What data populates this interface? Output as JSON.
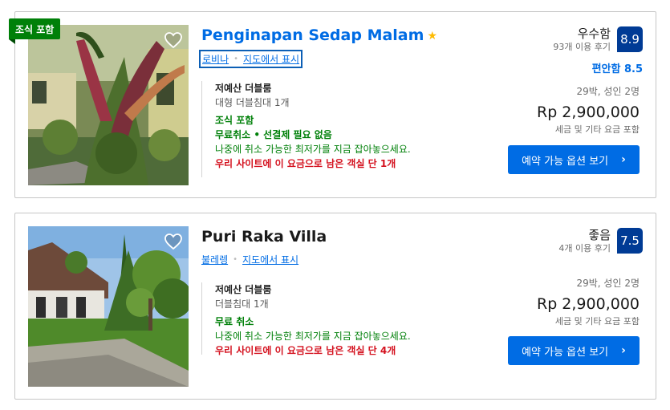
{
  "listings": [
    {
      "name": "Penginapan Sedap Malam",
      "star": "★",
      "ribbon": "조식 포함",
      "location": "로비나",
      "map_link": "지도에서 표시",
      "score_word": "우수함",
      "review_count": "93개 이용 후기",
      "score": "8.9",
      "comfort": "편안함 8.5",
      "room_title": "저예산 더블룸",
      "bed": "대형 더블침대 1개",
      "meal": "조식 포함",
      "cancel": "무료취소 • 선결제 필요 없음",
      "lock_note": "나중에 취소 가능한 최저가를 지금 잡아놓으세요.",
      "scarcity": "우리 사이트에 이 요금으로 남은 객실 단 1개",
      "stay": "29박, 성인 2명",
      "price": "Rp 2,900,000",
      "taxes": "세금 및 기타 요금 포함",
      "cta": "예약 가능 옵션 보기",
      "chevron": "›"
    },
    {
      "name": "Puri Raka Villa",
      "location": "불레렝",
      "map_link": "지도에서 표시",
      "score_word": "좋음",
      "review_count": "4개 이용 후기",
      "score": "7.5",
      "room_title": "저예산 더블룸",
      "bed": "더블침대 1개",
      "cancel": "무료 취소",
      "lock_note": "나중에 취소 가능한 최저가를 지금 잡아놓으세요.",
      "scarcity": "우리 사이트에 이 요금으로 남은 객실 단 4개",
      "stay": "29박, 성인 2명",
      "price": "Rp 2,900,000",
      "taxes": "세금 및 기타 요금 포함",
      "cta": "예약 가능 옵션 보기",
      "chevron": "›"
    }
  ],
  "colors": {
    "brand_blue": "#006ce4",
    "score_badge": "#003b95",
    "green": "#008009",
    "red": "#d4111e",
    "star": "#febb02"
  },
  "icons": [
    "heart-icon",
    "star-icon",
    "chevron-right-icon"
  ]
}
